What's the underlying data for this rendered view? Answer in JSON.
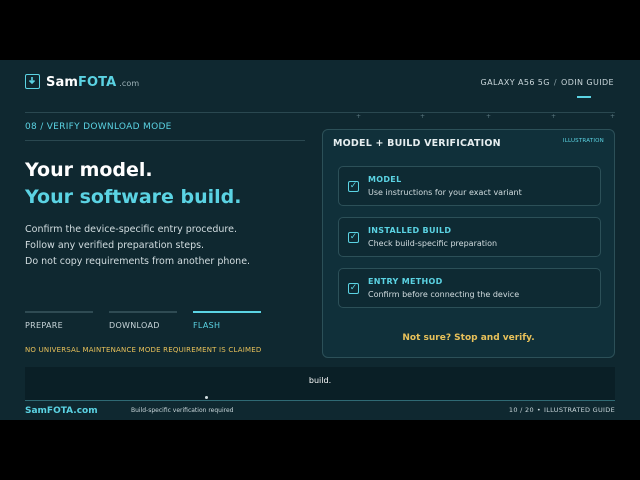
{
  "header": {
    "brand_main": "Sam",
    "brand_accent": "FOTA",
    "brand_suffix": ".com",
    "device": "GALAXY A56 5G",
    "separator": "/",
    "guide": "ODIN GUIDE",
    "logo_icon": "download-icon"
  },
  "left": {
    "step_label": "08 / VERIFY DOWNLOAD MODE",
    "title_line1": "Your model.",
    "title_line2": "Your software build.",
    "body": [
      "Confirm the device-specific entry procedure.",
      "Follow any verified preparation steps.",
      "Do not copy requirements from another phone."
    ],
    "phases": [
      "PREPARE",
      "DOWNLOAD",
      "FLASH"
    ],
    "active_phase": "FLASH",
    "disclaimer": "NO UNIVERSAL MAINTENANCE MODE REQUIREMENT IS CLAIMED"
  },
  "panel": {
    "title": "MODEL + BUILD VERIFICATION",
    "tag": "ILLUSTRATION",
    "cards": [
      {
        "title": "MODEL",
        "desc": "Use instructions for your exact variant",
        "icon": "checkbox-checked-icon"
      },
      {
        "title": "INSTALLED BUILD",
        "desc": "Check build-specific preparation",
        "icon": "checkbox-checked-icon"
      },
      {
        "title": "ENTRY METHOD",
        "desc": "Confirm before connecting the device",
        "icon": "checkbox-checked-icon"
      }
    ],
    "note": "Not sure? Stop and verify."
  },
  "subtitle": "build.",
  "footer": {
    "brand": "SamFOTA.com",
    "middle": "Build-specific verification required",
    "page": "10 / 20",
    "bullet": "•",
    "label": "ILLUSTRATED GUIDE"
  },
  "colors": {
    "background": "#0f2830",
    "accent": "#5bd3e3",
    "warning": "#e8c15a",
    "text": "#e6eef0"
  }
}
